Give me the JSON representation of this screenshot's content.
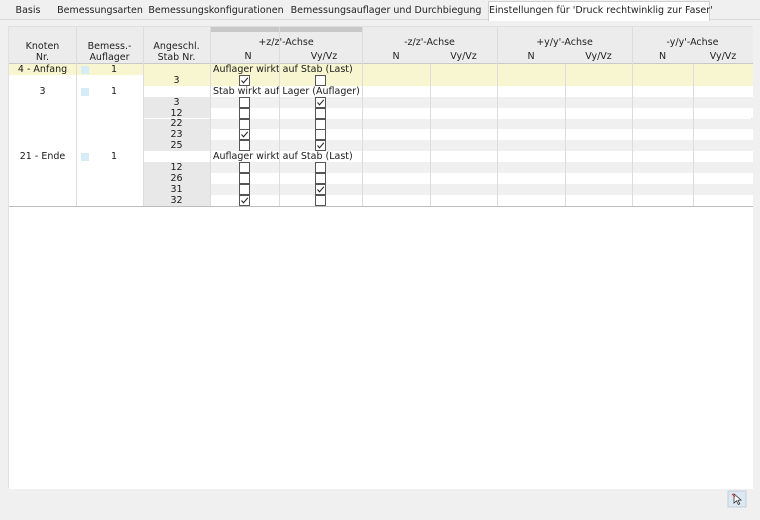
{
  "tabs": [
    {
      "label": "Basis",
      "active": false
    },
    {
      "label": "Bemessungsarten",
      "active": false
    },
    {
      "label": "Bemessungskonfigurationen",
      "active": false
    },
    {
      "label": "Bemessungsauflager und Durchbiegung",
      "active": false
    },
    {
      "label": "Einstellungen für 'Druck rechtwinklig zur Faser'",
      "active": true
    }
  ],
  "table": {
    "headers": {
      "knoten": [
        "Knoten",
        "Nr."
      ],
      "bemess": [
        "Bemess.-",
        "Auflager"
      ],
      "stab": [
        "Angeschl.",
        "Stab Nr."
      ],
      "groups": [
        "+z/z'-Achse",
        "-z/z'-Achse",
        "+y/y'-Achse",
        "-y/y'-Achse"
      ],
      "sub_n": "N",
      "sub_v": "Vy/Vz"
    },
    "groups": [
      {
        "knoten": "4 - Anfang",
        "auflager": "1",
        "text": "Auflager wirkt auf Stab (Last)",
        "highlight": true,
        "rows": [
          {
            "stab": "3",
            "n": true,
            "v": false
          }
        ]
      },
      {
        "knoten": "3",
        "auflager": "1",
        "text": "Stab wirkt auf Lager (Auflager)",
        "highlight": false,
        "rows": [
          {
            "stab": "3",
            "n": false,
            "v": true
          },
          {
            "stab": "12",
            "n": false,
            "v": false
          },
          {
            "stab": "22",
            "n": false,
            "v": false
          },
          {
            "stab": "23",
            "n": true,
            "v": false
          },
          {
            "stab": "25",
            "n": false,
            "v": true
          }
        ]
      },
      {
        "knoten": "21 - Ende",
        "auflager": "1",
        "text": "Auflager wirkt auf Stab (Last)",
        "highlight": false,
        "rows": [
          {
            "stab": "12",
            "n": false,
            "v": false
          },
          {
            "stab": "26",
            "n": false,
            "v": false
          },
          {
            "stab": "31",
            "n": false,
            "v": true
          },
          {
            "stab": "32",
            "n": true,
            "v": false
          }
        ]
      }
    ]
  },
  "colors": {
    "highlight_row": "#f7f6d0",
    "header_bg": "#ececec",
    "swatch": "#d6ecf7"
  },
  "icons": {
    "bottom_right": "cursor-select-icon"
  }
}
